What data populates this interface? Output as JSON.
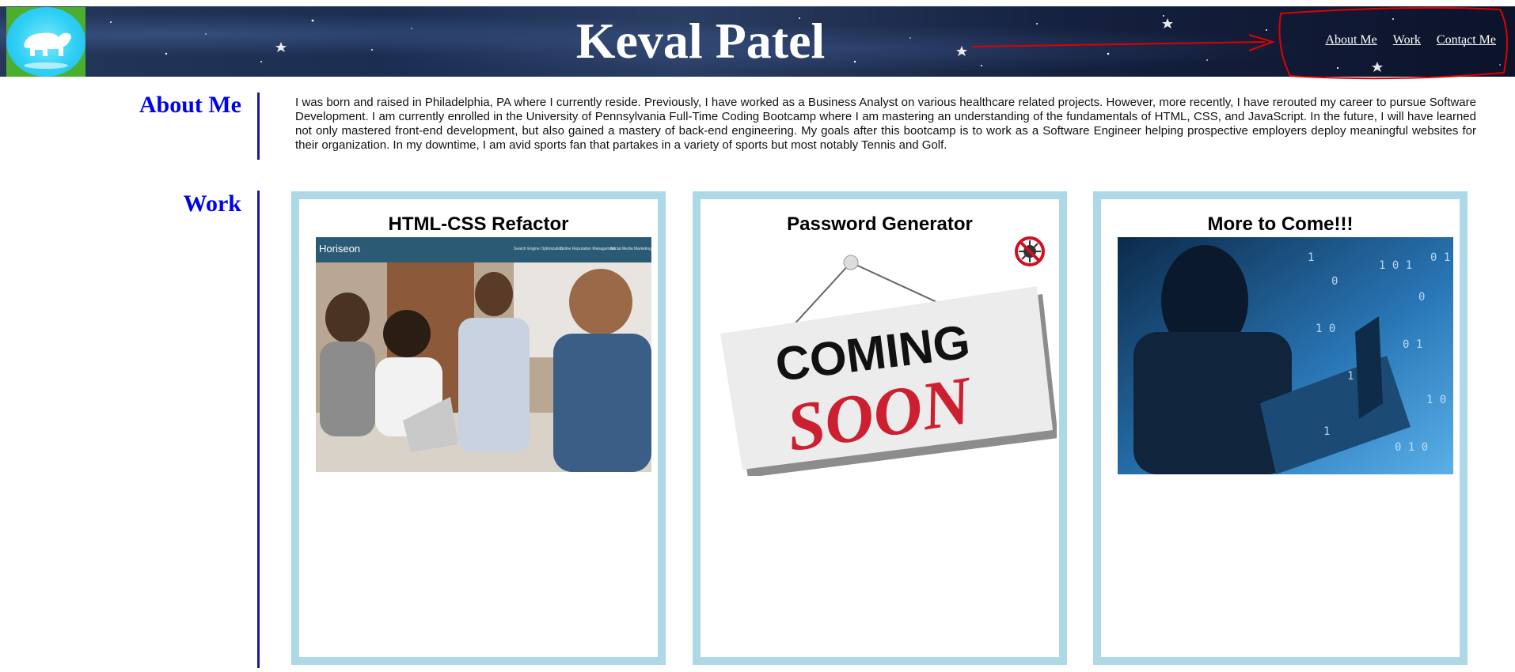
{
  "header": {
    "title": "Keval Patel",
    "logo_icon": "polar-bear-icon",
    "nav": [
      {
        "label": "About Me"
      },
      {
        "label": "Work"
      },
      {
        "label": "Contact Me"
      }
    ]
  },
  "about": {
    "heading": "About Me",
    "text": "I was born and raised in Philadelphia, PA where I currently reside. Previously, I have worked as a Business Analyst on various healthcare related projects. However, more recently, I have rerouted my career to pursue Software Development. I am currently enrolled in the University of Pennsylvania Full-Time Coding Bootcamp where I am mastering an understanding of the fundamentals of HTML, CSS, and JavaScript. In the future, I will have learned not only mastered front-end development, but also gained a mastery of back-end engineering. My goals after this bootcamp is to work as a Software Engineer helping prospective employers deploy meaningful websites for their organization. In my downtime, I am avid sports fan that partakes in a variety of sports but most notably Tennis and Golf."
  },
  "work": {
    "heading": "Work",
    "projects": [
      {
        "title": "HTML-CSS Refactor",
        "screenshot": {
          "brand": "Horiseon",
          "nav": [
            "Search Engine Optimization",
            "Online Reputation Management",
            "Social Media Marketing"
          ]
        }
      },
      {
        "title": "Password Generator",
        "sign": {
          "line1": "COMING",
          "line2": "SOON"
        }
      },
      {
        "title": "More to Come!!!"
      }
    ]
  },
  "colors": {
    "accent": "#0000ee",
    "card_border": "#add8e6",
    "annotation": "#e00000"
  }
}
